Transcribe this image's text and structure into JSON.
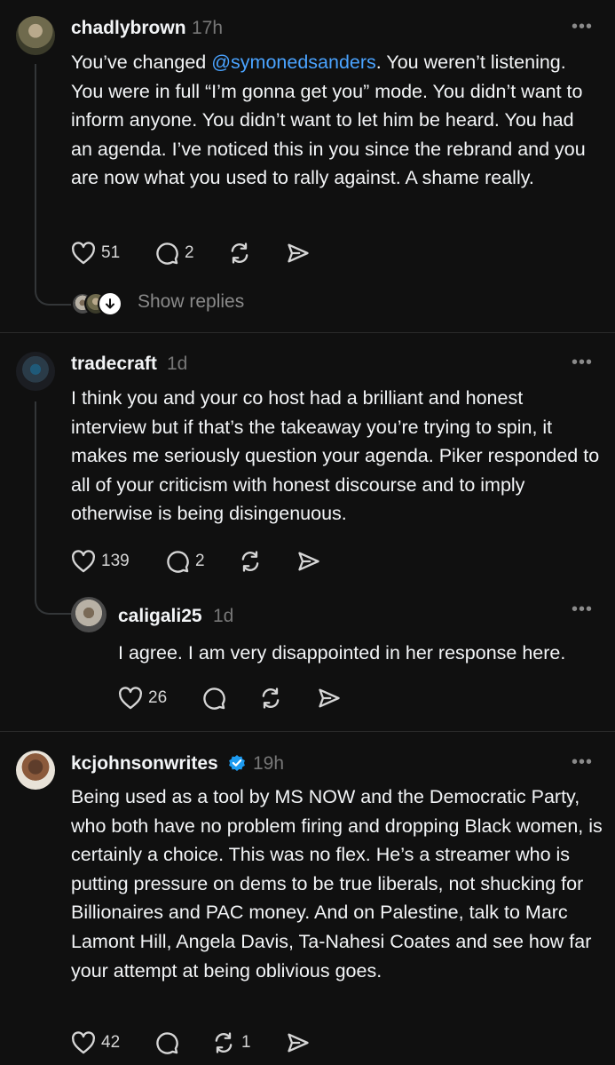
{
  "posts": [
    {
      "username": "chadlybrown",
      "time": "17h",
      "text_before": "You’ve changed ",
      "mention": "@symonedsanders",
      "text_after": ". You weren’t listening. You were in full “I’m gonna get you” mode. You didn’t want to inform anyone. You didn’t want to let him be heard. You had an agenda. I’ve noticed this in you since the rebrand and you are now what you used to rally against. A shame really.",
      "likes": "51",
      "replies": "2",
      "reposts": "",
      "show_replies": "Show replies"
    },
    {
      "username": "tradecraft",
      "time": "1d",
      "text": "I think you and your co host had a brilliant and honest interview but if that’s the takeaway you’re trying to spin, it makes me seriously question your agenda. Piker responded to all of your criticism with honest discourse and to imply otherwise is being disingenuous.",
      "likes": "139",
      "replies": "2",
      "reposts": "",
      "reply": {
        "username": "caligali25",
        "time": "1d",
        "text": "I agree. I am very disappointed in her response here.",
        "likes": "26",
        "replies": "",
        "reposts": ""
      }
    },
    {
      "username": "kcjohnsonwrites",
      "verified": true,
      "time": "19h",
      "text": "Being used as a tool by MS NOW and the Democratic Party, who both have no problem firing  and dropping Black women, is certainly a choice. This was no flex. He’s a streamer who is putting pressure on dems to be true liberals, not shucking for Billionaires and PAC money. And on Palestine, talk to  Marc Lamont Hill, Angela Davis, Ta-Nahesi Coates and see how far your attempt at being oblivious  goes.",
      "likes": "42",
      "replies": "",
      "reposts": "1"
    }
  ],
  "colors": {
    "background": "#101010",
    "text": "#f3f5f7",
    "muted": "#777777",
    "mention": "#4aa3ff",
    "verified": "#1d9bf0"
  },
  "icons": [
    "heart-icon",
    "comment-icon",
    "repost-icon",
    "share-icon",
    "more-icon",
    "verified-icon",
    "arrow-down-icon"
  ]
}
